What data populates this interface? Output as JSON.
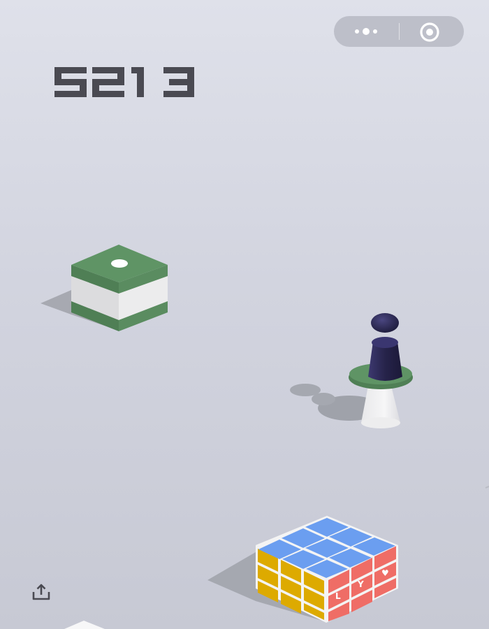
{
  "hud": {
    "score": "5213",
    "menu_icon": "more-dots-icon",
    "close_icon": "target-close-icon",
    "share_icon": "share-upload-icon"
  },
  "colors": {
    "score": "#4a4a52",
    "green_top": "#5f9465",
    "green_side": "#4f7f55",
    "cube_blue": "#6b9ef0",
    "cube_yellow": "#ddaa00",
    "cube_red": "#ef6d66",
    "player": "#2d2a55"
  },
  "scene": {
    "cube_face_letters": [
      "L",
      "Y",
      "♥"
    ]
  }
}
